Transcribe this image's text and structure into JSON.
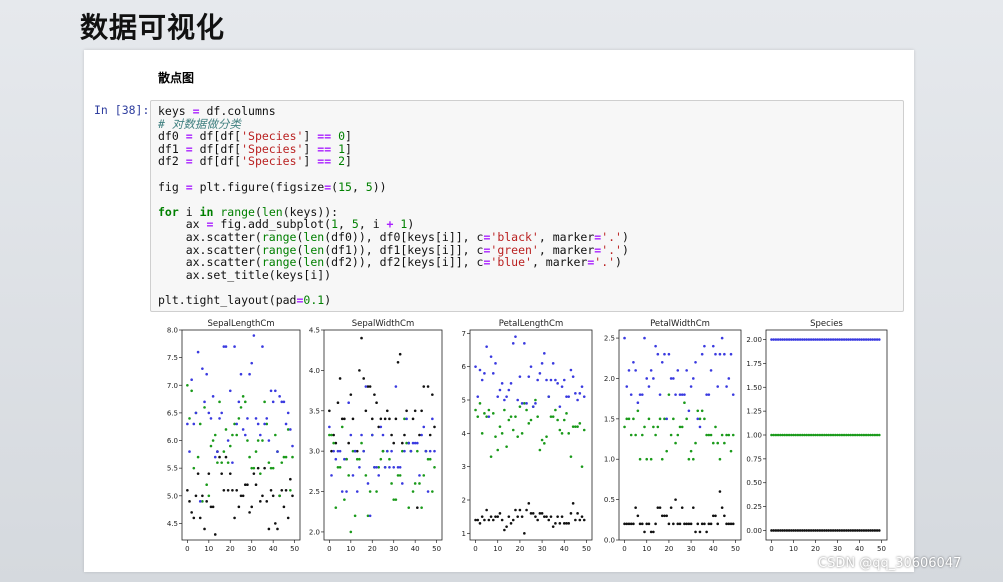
{
  "slide": {
    "title": "数据可视化"
  },
  "notebook": {
    "markdown_heading": "散点图",
    "cell_prompt": "In [38]:",
    "code_lines": [
      "keys = df.columns",
      "# 对数据做分类",
      "df0 = df[df['Species'] == 0]",
      "df1 = df[df['Species'] == 1]",
      "df2 = df[df['Species'] == 2]",
      "",
      "fig = plt.figure(figsize=(15, 5))",
      "",
      "for i in range(len(keys)):",
      "    ax = fig.add_subplot(1, 5, i + 1)",
      "    ax.scatter(range(len(df0)), df0[keys[i]], c='black', marker='.')",
      "    ax.scatter(range(len(df1)), df1[keys[i]], c='green', marker='.')",
      "    ax.scatter(range(len(df2)), df2[keys[i]], c='blue', marker='.')",
      "    ax.set_title(keys[i])",
      "",
      "plt.tight_layout(pad=0.1)"
    ]
  },
  "watermark": "CSDN @qq_30606047",
  "colors": {
    "series0": "#111111",
    "series1": "#1a9a1a",
    "series2": "#3a3ae0"
  },
  "chart_data": [
    {
      "type": "scatter",
      "title": "SepalLengthCm",
      "xlim": [
        0,
        50
      ],
      "ylim": [
        4.2,
        8.0
      ],
      "xticks": [
        0,
        10,
        20,
        30,
        40,
        50
      ],
      "yticks": [
        4.5,
        5.0,
        5.5,
        6.0,
        6.5,
        7.0,
        7.5,
        8.0
      ],
      "ytick_labels": [
        "4.5",
        "5.0",
        "5.5",
        "6.0",
        "6.5",
        "7.0",
        "7.5",
        "8.0"
      ],
      "series": [
        {
          "color": "black",
          "values": [
            5.1,
            4.9,
            4.7,
            4.6,
            5.0,
            5.4,
            4.6,
            5.0,
            4.4,
            4.9,
            5.4,
            4.8,
            4.8,
            4.3,
            5.8,
            5.7,
            5.4,
            5.1,
            5.7,
            5.1,
            5.4,
            5.1,
            4.6,
            5.1,
            4.8,
            5.0,
            5.0,
            5.2,
            5.2,
            4.7,
            4.8,
            5.4,
            5.2,
            5.5,
            4.9,
            5.0,
            5.5,
            4.9,
            4.4,
            5.1,
            5.0,
            4.5,
            4.4,
            5.0,
            5.1,
            4.8,
            5.1,
            4.6,
            5.3,
            5.0
          ]
        },
        {
          "color": "green",
          "values": [
            7.0,
            6.4,
            6.9,
            5.5,
            6.5,
            5.7,
            6.3,
            4.9,
            6.6,
            5.2,
            5.0,
            5.9,
            6.0,
            6.1,
            5.6,
            6.7,
            5.6,
            5.8,
            6.2,
            5.6,
            5.9,
            6.1,
            6.3,
            6.1,
            6.4,
            6.6,
            6.8,
            6.7,
            6.0,
            5.7,
            5.5,
            5.5,
            5.8,
            6.0,
            5.4,
            6.0,
            6.7,
            6.3,
            5.6,
            5.5,
            5.5,
            6.1,
            5.8,
            5.0,
            5.6,
            5.7,
            5.7,
            6.2,
            5.1,
            5.7
          ]
        },
        {
          "color": "blue",
          "values": [
            6.3,
            5.8,
            7.1,
            6.3,
            6.5,
            7.6,
            4.9,
            7.3,
            6.7,
            7.2,
            6.5,
            6.4,
            6.8,
            5.7,
            5.8,
            6.4,
            6.5,
            7.7,
            7.7,
            6.0,
            6.9,
            5.6,
            7.7,
            6.3,
            6.7,
            7.2,
            6.2,
            6.1,
            6.4,
            7.2,
            7.4,
            7.9,
            6.4,
            6.3,
            6.1,
            7.7,
            6.3,
            6.4,
            6.0,
            6.9,
            6.7,
            6.9,
            5.8,
            6.8,
            6.7,
            6.7,
            6.3,
            6.5,
            6.2,
            5.9
          ]
        }
      ]
    },
    {
      "type": "scatter",
      "title": "SepalWidthCm",
      "xlim": [
        0,
        50
      ],
      "ylim": [
        1.9,
        4.5
      ],
      "xticks": [
        0,
        10,
        20,
        30,
        40,
        50
      ],
      "yticks": [
        2.0,
        2.5,
        3.0,
        3.5,
        4.0,
        4.5
      ],
      "ytick_labels": [
        "2.0",
        "2.5",
        "3.0",
        "3.5",
        "4.0",
        "4.5"
      ],
      "series": [
        {
          "color": "black",
          "values": [
            3.5,
            3.0,
            3.2,
            3.1,
            3.6,
            3.9,
            3.4,
            3.4,
            2.9,
            3.1,
            3.7,
            3.4,
            3.0,
            3.0,
            4.0,
            4.4,
            3.9,
            3.5,
            3.8,
            3.8,
            3.4,
            3.7,
            3.6,
            3.3,
            3.4,
            3.0,
            3.4,
            3.5,
            3.4,
            3.2,
            3.1,
            3.4,
            4.1,
            4.2,
            3.1,
            3.2,
            3.5,
            3.1,
            3.0,
            3.4,
            3.5,
            2.3,
            3.2,
            3.5,
            3.8,
            3.0,
            3.8,
            3.2,
            3.7,
            3.3
          ]
        },
        {
          "color": "green",
          "values": [
            3.2,
            3.2,
            3.1,
            2.3,
            2.8,
            2.8,
            3.3,
            2.4,
            2.9,
            2.7,
            2.0,
            3.0,
            2.2,
            2.9,
            2.9,
            3.1,
            3.0,
            2.7,
            2.2,
            2.5,
            3.2,
            2.8,
            2.5,
            2.8,
            2.9,
            3.0,
            2.8,
            3.0,
            2.9,
            2.6,
            2.4,
            2.4,
            2.7,
            2.7,
            3.0,
            3.4,
            3.1,
            2.3,
            3.0,
            2.5,
            2.6,
            3.0,
            2.6,
            2.3,
            2.7,
            3.0,
            2.9,
            2.9,
            2.5,
            2.8
          ]
        },
        {
          "color": "blue",
          "values": [
            3.3,
            2.7,
            3.0,
            2.9,
            3.0,
            3.0,
            2.5,
            2.9,
            2.5,
            3.6,
            3.2,
            2.7,
            3.0,
            2.5,
            2.8,
            3.2,
            3.0,
            3.8,
            2.6,
            2.2,
            3.2,
            2.8,
            2.8,
            2.7,
            3.3,
            3.2,
            2.8,
            3.0,
            2.8,
            3.0,
            2.8,
            3.8,
            2.8,
            2.8,
            2.6,
            3.0,
            3.4,
            3.1,
            3.0,
            3.1,
            3.1,
            3.1,
            2.7,
            3.2,
            3.3,
            3.0,
            2.5,
            3.0,
            3.4,
            3.0
          ]
        }
      ]
    },
    {
      "type": "scatter",
      "title": "PetalLengthCm",
      "xlim": [
        0,
        50
      ],
      "ylim": [
        0.8,
        7.1
      ],
      "xticks": [
        0,
        10,
        20,
        30,
        40,
        50
      ],
      "yticks": [
        1,
        2,
        3,
        4,
        5,
        6,
        7
      ],
      "ytick_labels": [
        "1",
        "2",
        "3",
        "4",
        "5",
        "6",
        "7"
      ],
      "series": [
        {
          "color": "black",
          "values": [
            1.4,
            1.4,
            1.3,
            1.5,
            1.4,
            1.7,
            1.4,
            1.5,
            1.4,
            1.5,
            1.5,
            1.6,
            1.4,
            1.1,
            1.2,
            1.5,
            1.3,
            1.4,
            1.7,
            1.5,
            1.7,
            1.5,
            1.0,
            1.7,
            1.9,
            1.6,
            1.6,
            1.5,
            1.4,
            1.6,
            1.6,
            1.5,
            1.5,
            1.4,
            1.5,
            1.2,
            1.3,
            1.5,
            1.3,
            1.5,
            1.3,
            1.3,
            1.3,
            1.6,
            1.9,
            1.4,
            1.6,
            1.4,
            1.5,
            1.4
          ]
        },
        {
          "color": "green",
          "values": [
            4.7,
            4.5,
            4.9,
            4.0,
            4.6,
            4.5,
            4.7,
            3.3,
            4.6,
            3.9,
            3.5,
            4.2,
            4.0,
            4.7,
            3.6,
            4.4,
            4.5,
            4.1,
            4.5,
            3.9,
            4.8,
            4.0,
            4.9,
            4.7,
            4.3,
            4.4,
            4.8,
            5.0,
            4.5,
            3.5,
            3.8,
            3.7,
            3.9,
            5.1,
            4.5,
            4.5,
            4.7,
            4.4,
            4.1,
            4.0,
            4.4,
            4.6,
            4.0,
            3.3,
            4.2,
            4.2,
            4.2,
            4.3,
            3.0,
            4.1
          ]
        },
        {
          "color": "blue",
          "values": [
            6.0,
            5.1,
            5.9,
            5.6,
            5.8,
            6.6,
            4.5,
            6.3,
            5.8,
            6.1,
            5.1,
            5.3,
            5.5,
            5.0,
            5.1,
            5.3,
            5.5,
            6.7,
            6.9,
            5.0,
            5.7,
            4.9,
            6.7,
            4.9,
            5.7,
            6.0,
            4.8,
            4.9,
            5.6,
            5.8,
            6.1,
            6.4,
            5.6,
            5.1,
            5.6,
            6.1,
            5.6,
            5.5,
            4.8,
            5.4,
            5.6,
            5.1,
            5.1,
            5.9,
            5.7,
            5.2,
            5.0,
            5.2,
            5.4,
            5.1
          ]
        }
      ]
    },
    {
      "type": "scatter",
      "title": "PetalWidthCm",
      "xlim": [
        0,
        50
      ],
      "ylim": [
        0.0,
        2.6
      ],
      "xticks": [
        0,
        10,
        20,
        30,
        40,
        50
      ],
      "yticks": [
        0.0,
        0.5,
        1.0,
        1.5,
        2.0,
        2.5
      ],
      "ytick_labels": [
        "0.0",
        "0.5",
        "1.0",
        "1.5",
        "2.0",
        "2.5"
      ],
      "series": [
        {
          "color": "black",
          "values": [
            0.2,
            0.2,
            0.2,
            0.2,
            0.2,
            0.4,
            0.3,
            0.2,
            0.2,
            0.1,
            0.2,
            0.2,
            0.1,
            0.1,
            0.2,
            0.4,
            0.4,
            0.3,
            0.3,
            0.3,
            0.2,
            0.4,
            0.2,
            0.5,
            0.2,
            0.2,
            0.4,
            0.2,
            0.2,
            0.2,
            0.2,
            0.4,
            0.1,
            0.2,
            0.1,
            0.2,
            0.2,
            0.1,
            0.2,
            0.2,
            0.3,
            0.3,
            0.2,
            0.6,
            0.4,
            0.3,
            0.2,
            0.2,
            0.2,
            0.2
          ]
        },
        {
          "color": "green",
          "values": [
            1.4,
            1.5,
            1.5,
            1.3,
            1.5,
            1.3,
            1.6,
            1.0,
            1.3,
            1.4,
            1.0,
            1.5,
            1.0,
            1.4,
            1.3,
            1.4,
            1.5,
            1.0,
            1.5,
            1.1,
            1.8,
            1.3,
            1.5,
            1.2,
            1.3,
            1.4,
            1.4,
            1.7,
            1.5,
            1.0,
            1.1,
            1.0,
            1.2,
            1.6,
            1.5,
            1.6,
            1.5,
            1.3,
            1.3,
            1.3,
            1.2,
            1.4,
            1.2,
            1.0,
            1.3,
            1.2,
            1.3,
            1.3,
            1.1,
            1.3
          ]
        },
        {
          "color": "blue",
          "values": [
            2.5,
            1.9,
            2.1,
            1.8,
            2.2,
            2.1,
            1.7,
            1.8,
            1.8,
            2.5,
            2.0,
            1.9,
            2.1,
            2.0,
            2.4,
            2.3,
            1.8,
            2.2,
            2.3,
            1.5,
            2.3,
            2.0,
            2.0,
            1.8,
            2.1,
            1.8,
            1.8,
            1.8,
            2.1,
            1.6,
            1.9,
            2.0,
            2.2,
            1.5,
            1.4,
            2.3,
            2.4,
            1.8,
            1.8,
            2.1,
            2.4,
            2.3,
            1.9,
            2.3,
            2.5,
            2.3,
            1.9,
            2.0,
            2.3,
            1.8
          ]
        }
      ]
    },
    {
      "type": "scatter",
      "title": "Species",
      "xlim": [
        0,
        50
      ],
      "ylim": [
        -0.1,
        2.1
      ],
      "xticks": [
        0,
        10,
        20,
        30,
        40,
        50
      ],
      "yticks": [
        0.0,
        0.25,
        0.5,
        0.75,
        1.0,
        1.25,
        1.5,
        1.75,
        2.0
      ],
      "ytick_labels": [
        "0.00",
        "0.25",
        "0.50",
        "0.75",
        "1.00",
        "1.25",
        "1.50",
        "1.75",
        "2.00"
      ],
      "series": [
        {
          "color": "black",
          "constant": 0,
          "count": 50
        },
        {
          "color": "green",
          "constant": 1,
          "count": 50
        },
        {
          "color": "blue",
          "constant": 2,
          "count": 50
        }
      ]
    }
  ]
}
